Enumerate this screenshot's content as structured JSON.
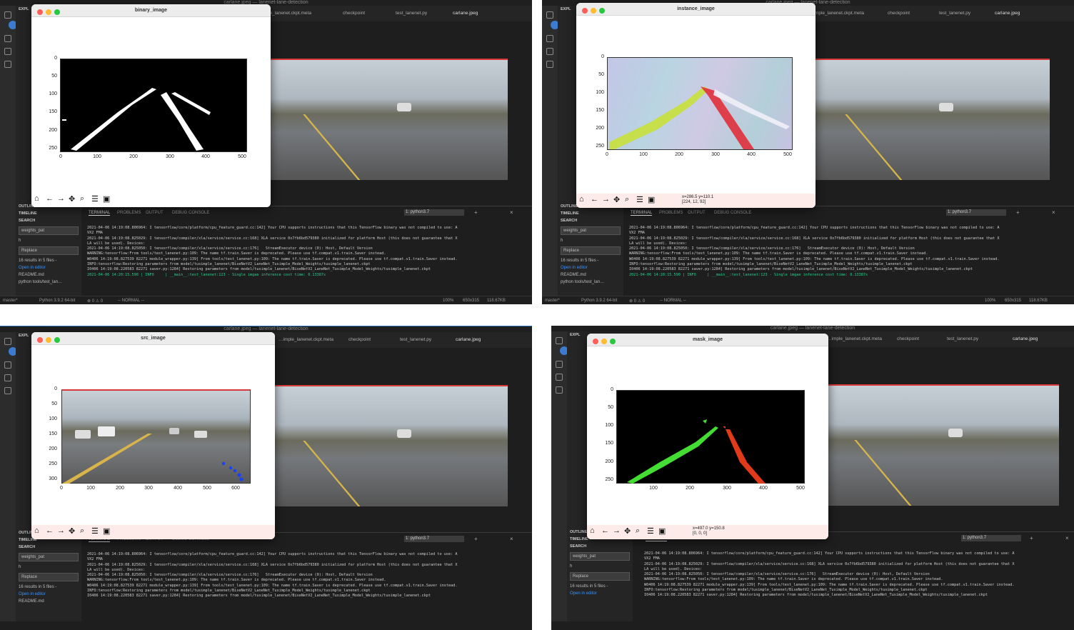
{
  "colors": {
    "terminal_green": "#23d18b",
    "lane_green": "#44dd33",
    "lane_red": "#e03a1a",
    "mask_blue": "#1840ff"
  },
  "vscode": {
    "window_title": "carlane.jpeg — lanenet-lane-detection",
    "explorer_label": "EXPL",
    "tabs": {
      "meta": "…imple_lanenet.ckpt.meta",
      "checkpoint": "checkpoint",
      "test_lanenet": "test_lanenet.py",
      "carlane": "carlane.jpeg"
    },
    "sidebar": {
      "outline": "OUTLINE",
      "timeline": "TIMELINE",
      "search": "SEARCH",
      "search_value": "weights_pat",
      "search_h": "h",
      "replace": "Replace",
      "results": "16 results in 5 files -",
      "open_editor": "Open in editor",
      "readme": "README.md",
      "readme_badge": "2",
      "cmd": "python tools/test_lan…"
    },
    "panel": {
      "terminal": "TERMINAL",
      "problems": "PROBLEMS",
      "output": "OUTPUT",
      "debug": "DEBUG CONSOLE",
      "shell": "1: python3.7"
    },
    "terminal_lines": [
      "2021-04-06 14:19:08.806964: I tensorflow/core/platform/cpu_feature_guard.cc:142] Your CPU supports instructions that this TensorFlow binary was not compiled to use: A",
      "VX2 FMA",
      "2021-04-06 14:19:08.825029: I tensorflow/compiler/xla/service/service.cc:168] XLA service 0x7fb6bd579380 initialized for platform Host (this does not guarantee that X",
      "LA will be used). Devices:",
      "2021-04-06 14:19:08.825050: I tensorflow/compiler/xla/service/service.cc:176]   StreamExecutor device (0): Host, Default Version",
      "WARNING:tensorflow:From tools/test_lanenet.py:109: The name tf.train.Saver is deprecated. Please use tf.compat.v1.train.Saver instead.",
      "",
      "W0406 14:19:08.827539 82271 module_wrapper.py:139] From tools/test_lanenet.py:109: The name tf.train.Saver is deprecated. Please use tf.compat.v1.train.Saver instead.",
      "",
      "INFO:tensorflow:Restoring parameters from model/tusimple_lanenet/BiseNetV2_LaneNet_Tusimple_Model_Weights/tusimple_lanenet.ckpt",
      "I0406 14:19:08.220583 82271 saver.py:1284] Restoring parameters from model/tusimple_lanenet/BiseNetV2_LaneNet_Tusimple_Model_Weights/tusimple_lanenet.ckpt"
    ],
    "terminal_last": "2021-04-06 14:20:15.590 | INFO     | __main__:test_lanenet:123 - Single imgae inference cost time: 0.13387s",
    "status": {
      "branch": "master*",
      "python": "Python 3.9.2 64-bit",
      "problems": "⊗ 0 ⚠ 0",
      "mode": "-- NORMAL --",
      "zoom": "100%",
      "dims": "650x315",
      "size": "118.67KB"
    }
  },
  "plots": {
    "binary": {
      "title": "binary_image",
      "y_ticks": [
        "0",
        "50",
        "100",
        "150",
        "200",
        "250"
      ],
      "x_ticks": [
        "0",
        "100",
        "200",
        "300",
        "400",
        "500"
      ]
    },
    "instance": {
      "title": "instance_image",
      "y_ticks": [
        "0",
        "50",
        "100",
        "150",
        "200",
        "250"
      ],
      "x_ticks": [
        "0",
        "100",
        "200",
        "300",
        "400",
        "500"
      ],
      "coord": "x=286.5 y=110.1",
      "rgb": "[224, 12, 92]"
    },
    "src": {
      "title": "src_image",
      "y_ticks": [
        "0",
        "50",
        "100",
        "150",
        "200",
        "250",
        "300"
      ],
      "x_ticks": [
        "0",
        "100",
        "200",
        "300",
        "400",
        "500",
        "600"
      ]
    },
    "mask": {
      "title": "mask_image",
      "y_ticks": [
        "0",
        "50",
        "100",
        "150",
        "200",
        "250"
      ],
      "x_ticks": [
        "100",
        "200",
        "300",
        "400",
        "500"
      ],
      "coord": "x=497.0 y=150.8",
      "rgb": "[0, 0, 0]"
    }
  },
  "toolbar_icons": [
    "home-icon",
    "back-icon",
    "forward-icon",
    "pan-icon",
    "zoom-icon",
    "configure-icon",
    "save-icon"
  ]
}
